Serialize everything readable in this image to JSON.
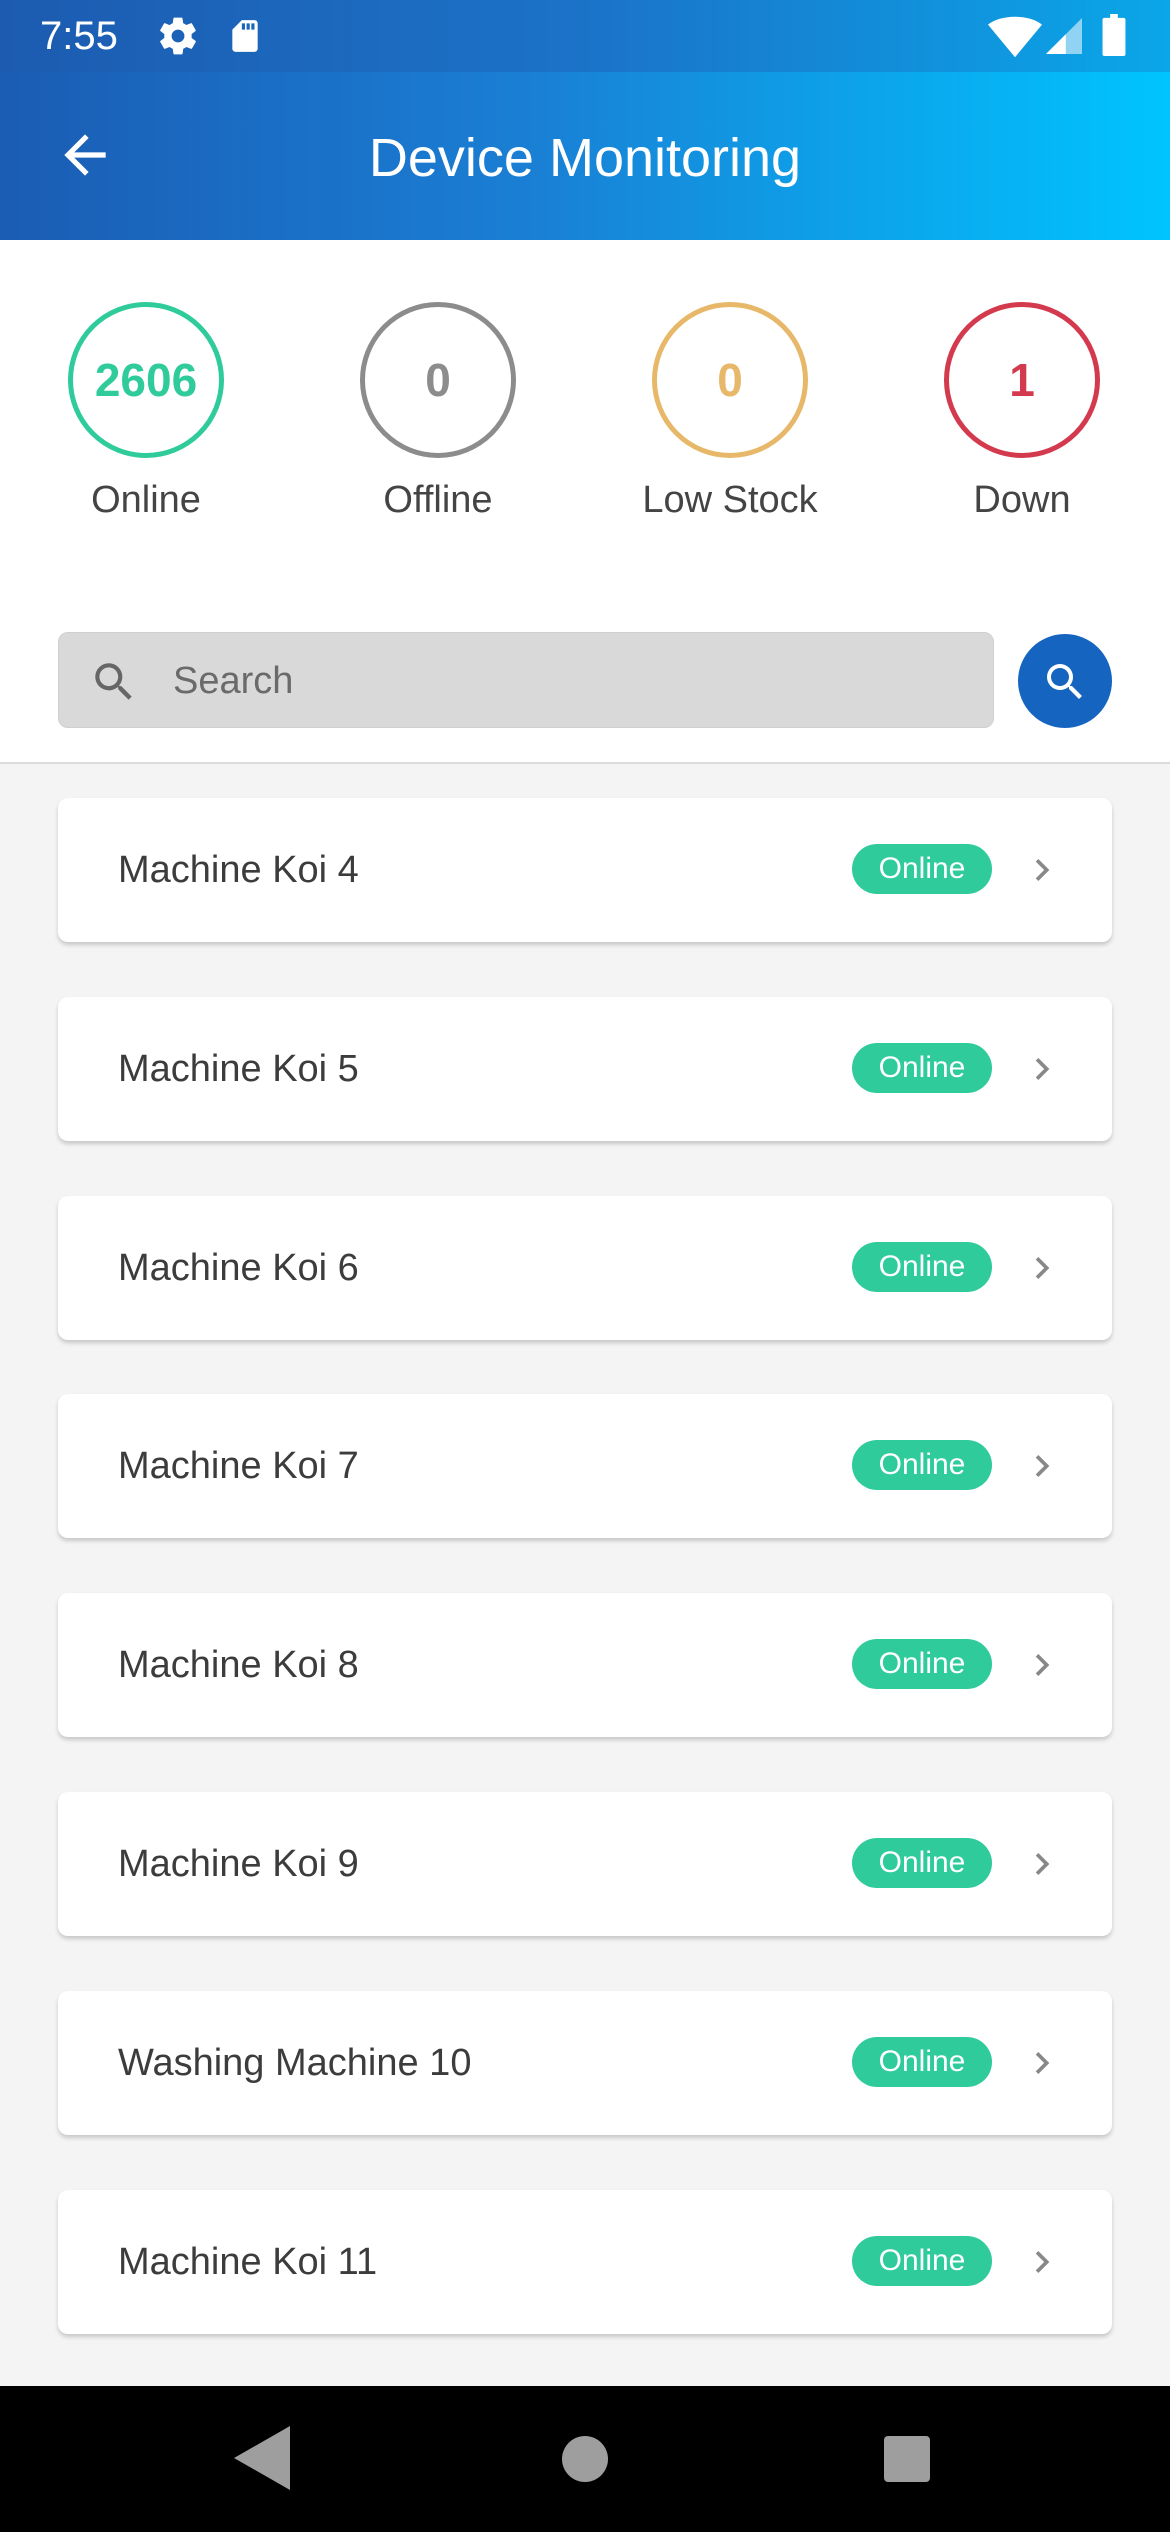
{
  "status_bar": {
    "time": "7:55",
    "icons": [
      "gear-icon",
      "sd-card-icon",
      "wifi-icon",
      "signal-icon",
      "battery-icon"
    ]
  },
  "app_bar": {
    "title": "Device Monitoring",
    "back_icon": "arrow-left-icon"
  },
  "colors": {
    "online": "#2fcb9b",
    "offline": "#8c8c8c",
    "low_stock": "#e8b86a",
    "down": "#d33a4e",
    "primary": "#1565c0"
  },
  "stats": [
    {
      "value": "2606",
      "label": "Online"
    },
    {
      "value": "0",
      "label": "Offline"
    },
    {
      "value": "0",
      "label": "Low Stock"
    },
    {
      "value": "1",
      "label": "Down"
    }
  ],
  "search": {
    "placeholder": "Search",
    "value": ""
  },
  "devices": [
    {
      "name": "Machine Koi 4",
      "status": "Online"
    },
    {
      "name": "Machine Koi 5",
      "status": "Online"
    },
    {
      "name": "Machine Koi 6",
      "status": "Online"
    },
    {
      "name": "Machine Koi 7",
      "status": "Online"
    },
    {
      "name": "Machine Koi 8",
      "status": "Online"
    },
    {
      "name": "Machine Koi 9",
      "status": "Online"
    },
    {
      "name": "Washing Machine 10",
      "status": "Online"
    },
    {
      "name": "Machine Koi 11",
      "status": "Online"
    }
  ]
}
